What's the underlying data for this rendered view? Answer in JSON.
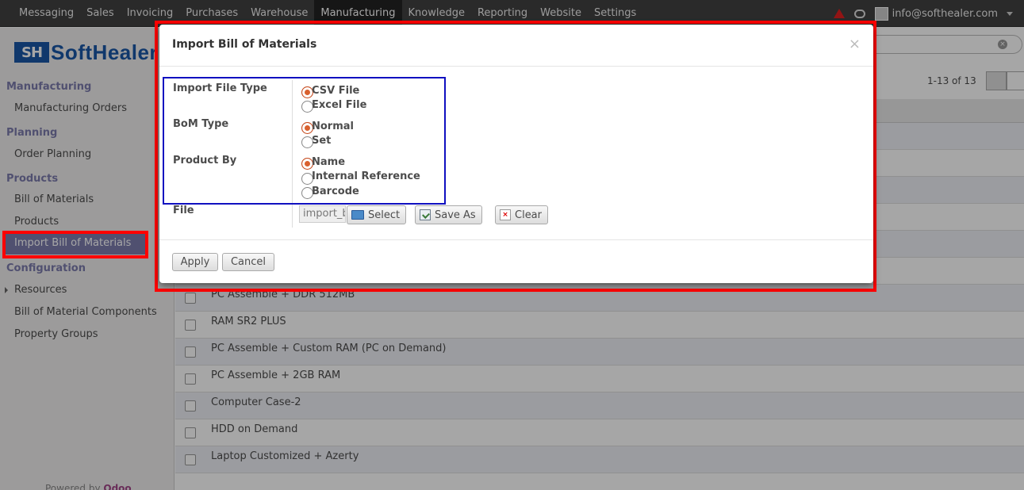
{
  "topbar": {
    "menu": [
      "Messaging",
      "Sales",
      "Invoicing",
      "Purchases",
      "Warehouse",
      "Manufacturing",
      "Knowledge",
      "Reporting",
      "Website",
      "Settings"
    ],
    "active": "Manufacturing",
    "user": "info@softhealer.com"
  },
  "logo": {
    "mark": "SH",
    "name": "SoftHealer"
  },
  "sidebar": {
    "sections": [
      {
        "title": "Manufacturing",
        "items": [
          "Manufacturing Orders"
        ]
      },
      {
        "title": "Planning",
        "items": [
          "Order Planning"
        ]
      },
      {
        "title": "Products",
        "items": [
          "Bill of Materials",
          "Products",
          "Import Bill of Materials"
        ]
      },
      {
        "title": "Configuration",
        "items": [
          "Resources",
          "Bill of Material Components",
          "Property Groups"
        ]
      }
    ],
    "active_item": "Import Bill of Materials",
    "powered_prefix": "Powered by",
    "powered_brand": "Odoo"
  },
  "list": {
    "pager": "1-13 of 13",
    "rows": [
      "PC Assemble + DDR 512MB",
      "RAM SR2 PLUS",
      "PC Assemble + Custom RAM (PC on Demand)",
      "PC Assemble + 2GB RAM",
      "Computer Case-2",
      "HDD on Demand",
      "Laptop Customized + Azerty"
    ]
  },
  "modal": {
    "title": "Import Bill of Materials",
    "close": "×",
    "fields": {
      "import_file_type": {
        "label": "Import File Type",
        "options": [
          "CSV File",
          "Excel File"
        ],
        "selected": "CSV File"
      },
      "bom_type": {
        "label": "BoM Type",
        "options": [
          "Normal",
          "Set"
        ],
        "selected": "Normal"
      },
      "product_by": {
        "label": "Product By",
        "options": [
          "Name",
          "Internal Reference",
          "Barcode"
        ],
        "selected": "Name"
      },
      "file": {
        "label": "File",
        "value": "import_b"
      }
    },
    "file_buttons": {
      "select": "Select",
      "save_as": "Save As",
      "clear": "Clear"
    },
    "actions": {
      "apply": "Apply",
      "cancel": "Cancel"
    }
  },
  "colors": {
    "highlight_red": "#ff0000",
    "highlight_blue": "#1010c0",
    "accent": "#7c7bad",
    "radio_on": "#d9612f"
  }
}
